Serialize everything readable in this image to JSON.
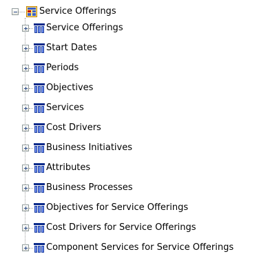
{
  "tree": {
    "root": {
      "label": "Service Offerings",
      "icon": "cube-folder-icon",
      "expanded": true
    },
    "children": [
      {
        "label": "Service Offerings",
        "icon": "dimension-icon",
        "expanded": false
      },
      {
        "label": "Start Dates",
        "icon": "dimension-icon",
        "expanded": false
      },
      {
        "label": "Periods",
        "icon": "dimension-icon",
        "expanded": false
      },
      {
        "label": "Objectives",
        "icon": "dimension-icon",
        "expanded": false
      },
      {
        "label": "Services",
        "icon": "dimension-icon",
        "expanded": false
      },
      {
        "label": "Cost Drivers",
        "icon": "dimension-icon",
        "expanded": false
      },
      {
        "label": "Business Initiatives",
        "icon": "dimension-icon",
        "expanded": false
      },
      {
        "label": "Attributes",
        "icon": "dimension-icon",
        "expanded": false
      },
      {
        "label": "Business Processes",
        "icon": "dimension-icon",
        "expanded": false
      },
      {
        "label": "Objectives for Service Offerings",
        "icon": "dimension-icon",
        "expanded": false
      },
      {
        "label": "Cost Drivers for Service Offerings",
        "icon": "dimension-icon",
        "expanded": false
      },
      {
        "label": "Component Services for Service Offerings",
        "icon": "dimension-icon",
        "expanded": false
      }
    ]
  },
  "colors": {
    "icon_blue": "#1f3f9f",
    "icon_header": "#0a2a8a",
    "root_icon_border": "#c08000",
    "root_icon_fill": "#ffe680"
  }
}
